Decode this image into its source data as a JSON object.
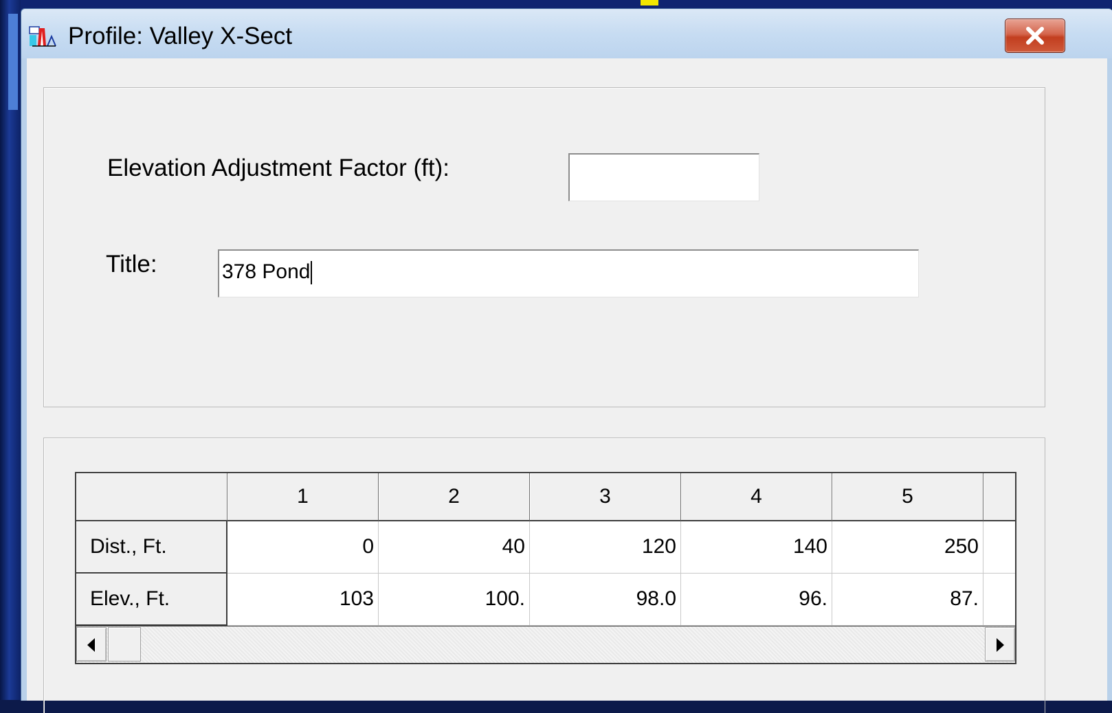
{
  "window": {
    "title": "Profile: Valley X-Sect",
    "icon": "profile-app-icon",
    "close_icon": "close-icon"
  },
  "form": {
    "elevation_label": "Elevation Adjustment Factor (ft):",
    "elevation_value": "",
    "title_label": "Title:",
    "title_value": "378 Pond"
  },
  "grid": {
    "columns": [
      "",
      "1",
      "2",
      "3",
      "4",
      "5"
    ],
    "rows": [
      {
        "label": "Dist., Ft.",
        "values": [
          "0",
          "40",
          "120",
          "140",
          "250"
        ]
      },
      {
        "label": "Elev., Ft.",
        "values": [
          "103",
          "100.",
          "98.0",
          "96.",
          "87."
        ]
      }
    ]
  },
  "scrollbar": {
    "left_icon": "arrow-left-icon",
    "right_icon": "arrow-right-icon"
  }
}
